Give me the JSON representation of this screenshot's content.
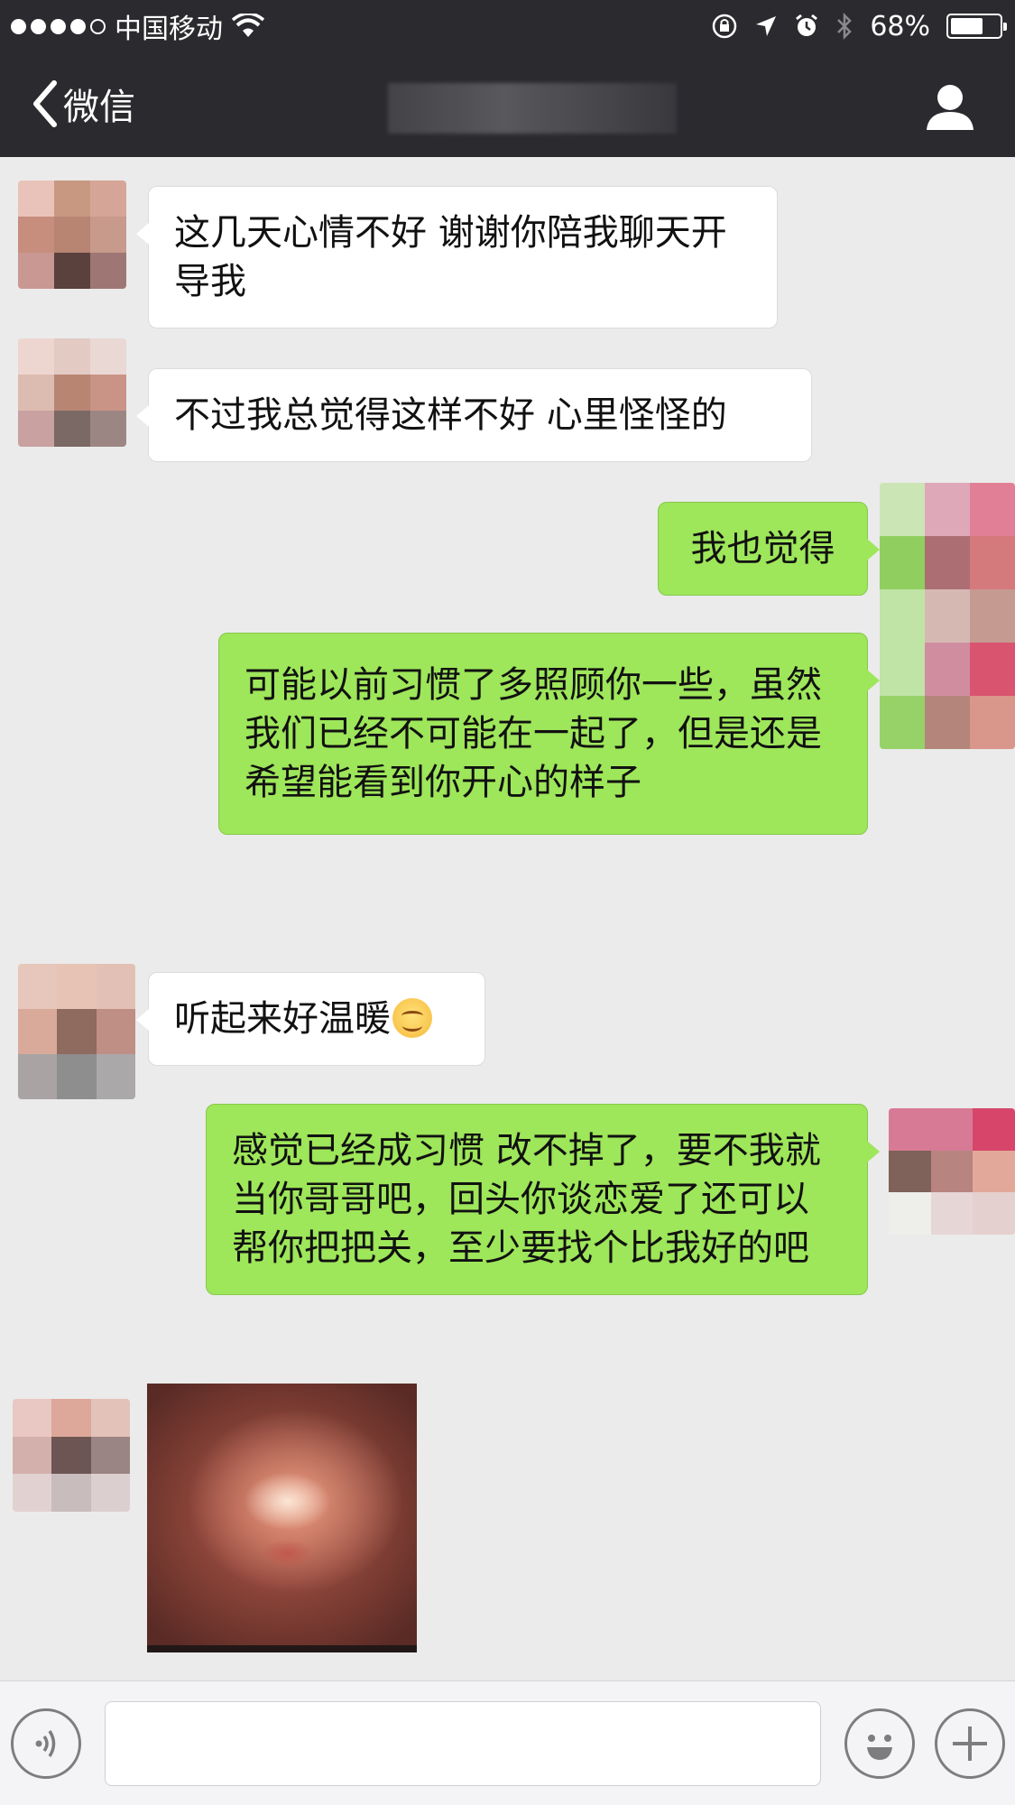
{
  "status_bar": {
    "carrier": "中国移动",
    "battery": "68%",
    "battery_level": 0.68
  },
  "nav": {
    "back_label": "微信"
  },
  "messages": [
    {
      "direction": "incoming",
      "text": "这几天心情不好 谢谢你陪我聊天开导我"
    },
    {
      "direction": "incoming",
      "text": "不过我总觉得这样不好 心里怪怪的"
    },
    {
      "direction": "outgoing",
      "text": "我也觉得"
    },
    {
      "direction": "outgoing",
      "text": "可能以前习惯了多照顾你一些，虽然我们已经不可能在一起了，但是还是希望能看到你开心的样子"
    },
    {
      "direction": "incoming",
      "text": "听起来好温暖"
    },
    {
      "direction": "outgoing",
      "text": "感觉已经成习惯 改不掉了，要不我就当你哥哥吧，回头你谈恋爱了还可以帮你把把关，至少要找个比我好的吧"
    },
    {
      "direction": "incoming",
      "type": "image"
    }
  ],
  "input": {
    "value": ""
  },
  "colors": {
    "bar_bg": "#2b2b2f",
    "chat_bg": "#ebebeb",
    "outgoing_bubble": "#9ee65a",
    "incoming_bubble": "#ffffff"
  }
}
